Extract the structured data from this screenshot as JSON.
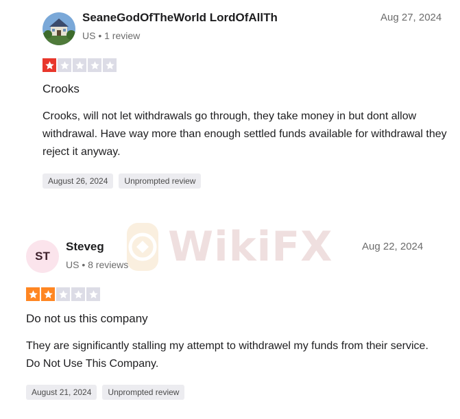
{
  "reviews": [
    {
      "author": "SeaneGodOfTheWorld LordOfAllTh",
      "meta": "US • 1 review",
      "date": "Aug 27, 2024",
      "rating": 1,
      "rating_color": "#e8372c",
      "title": "Crooks",
      "body": "Crooks, will not let withdrawals go through, they take money in but dont allow withdrawal. Have way more than enough settled funds available for withdrawal they reject it anyway.",
      "tags": [
        "August 26, 2024",
        "Unprompted review"
      ]
    },
    {
      "author": "Steveg",
      "initials": "ST",
      "meta": "US • 8 reviews",
      "date": "Aug 22, 2024",
      "rating": 2,
      "rating_color": "#ff8622",
      "title": "Do not us this company",
      "body": "They are significantly stalling my attempt to withdrawel my funds from their service. Do Not Use This Company.",
      "tags": [
        "August 21, 2024",
        "Unprompted review"
      ]
    }
  ],
  "watermark": {
    "text": "WikiFX"
  }
}
